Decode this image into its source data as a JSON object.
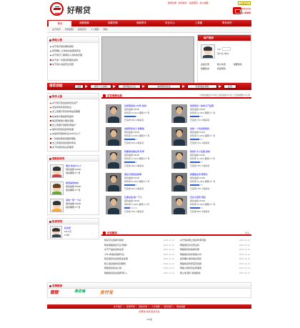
{
  "site": {
    "name": "好帮贷"
  },
  "toplinks": [
    "免费注册",
    "新手指引",
    "设置首页",
    "加入收藏"
  ],
  "register_btn": "注册会员",
  "hotline": {
    "label": "全国客服服务热线",
    "number": "400-622-4880"
  },
  "nav": [
    "首页",
    "我要借款",
    "我要贷款",
    "借款帮手",
    "安全中心",
    "工具箱",
    "联系我们"
  ],
  "subnav": [
    "关于我们",
    "风险控制",
    "担保贷款",
    "个人理财",
    "帮助"
  ],
  "notice": {
    "title": "网站公告",
    "items": [
      "关于我们借款审核通知",
      "如何确认,让你的资金更加安全",
      "关于我们了解借款人资料的管理",
      "关于第一次借款所需的资料",
      "关于用户资金安全问题"
    ]
  },
  "login": {
    "title": "用户登录",
    "uid_label": "UID",
    "avatar_tip": "用户名,你好!",
    "links": [
      "资金记录",
      "帐户充值",
      "我要借款",
      "我要投资",
      "找回密码"
    ]
  },
  "flow": {
    "title": "借贷流程:",
    "steps": [
      "注册",
      "填写个人资料",
      "身份信息认证",
      "发布借款/投资",
      "标满,借出到账",
      "还款"
    ]
  },
  "newsA": {
    "title": "换手上路",
    "items": [
      "关于我们选出最新优化资产",
      "去如何用手续费信息",
      "去三家银行存款利率是否需要",
      "在信用卡能提取现金吗",
      "借贷转帐账户服务流程",
      "去三家银行选择利率提升",
      "借款对找借出如何处理",
      "在借款有限的利息3000元以下",
      "一款借款审批流程有哪些",
      "去三家借款完成借款申请",
      "关于新借款的注意事项"
    ]
  },
  "borrowers": {
    "title": "借款指导员",
    "items": [
      {
        "name": "朋友,你在什么人",
        "amount": "借款金额:¥2000",
        "term": "借款期限:3个月"
      },
      {
        "name": "我想得到你的",
        "amount": "借款金额:¥5000",
        "term": "借款期限:3个月"
      },
      {
        "name": "满满一家一个好",
        "amount": "借款金额:¥3000",
        "term": "借款期限:3个月"
      }
    ]
  },
  "investors": {
    "title": "投资学院",
    "items": [
      {
        "name": "投资者",
        "amount": "¥11.5万",
        "term": "2.5年"
      }
    ]
  },
  "loans": {
    "title": "正在借款信息",
    "stats": "平均投资额度:¥2.99亿 | 投资总额:¥8.3亿 | 已投资笔数:6.6万笔",
    "items": [
      {
        "t": "好想借钱的小伙伴,信誉",
        "a": "借款金额:¥5000",
        "r": "年利率:19.00% 期限:6个月",
        "p": "已完成:89% 2笔投标"
      },
      {
        "t": "我想购买一些电子产品啊",
        "a": "借款金额:¥3000",
        "r": "年利率:14.00% 期限:1个月",
        "p": "已完成:74% 0笔投标"
      },
      {
        "t": "说想装修房子,我要借",
        "a": "借款金额:¥3000",
        "r": "年利率:13.00% 期限:5个月",
        "p": "已完成:82% 2笔投标"
      },
      {
        "t": "给我一个机会吧借钱",
        "a": "借款金额:¥2000",
        "r": "年利率:10.00% 期限:2个月",
        "p": "已完成:72% 1笔投标"
      },
      {
        "t": "想要借钱做生意,利率",
        "a": "借款金额:¥8000",
        "r": "年利率:14.00% 期限:6个月",
        "p": "已完成:84% 2笔投标"
      },
      {
        "t": "借钱扩大小店面,谢谢",
        "a": "借款金额:¥1500",
        "r": "年利率:11.00% 期限:1个月",
        "p": "已完成:78% 1笔投标"
      },
      {
        "t": "朋友们借钱给我啊",
        "a": "借款金额:¥5000",
        "r": "年利率:15.00% 期限:6个月",
        "p": "已完成:85% 3笔投标"
      },
      {
        "t": "我要做生意,帮帮忙",
        "a": "借款金额:¥1000",
        "r": "年利率:12.00% 期限:3个月",
        "p": "已完成:70% 1笔投标"
      },
      {
        "t": "急需资金,做一下小",
        "a": "借款金额:¥3000",
        "r": "年利率:11.00% 期限:1个月",
        "p": "已完成:45% 1笔投标"
      },
      {
        "t": "买房子装修,借钱",
        "a": "借款金额:¥2000",
        "r": "年利率:10.00% 期限:2个月",
        "p": "已完成:80% 2笔投标"
      }
    ]
  },
  "forum": {
    "title": "论坛精华",
    "left": [
      [
        "借贷平台选择与辨别",
        "2021-11-14"
      ],
      [
        "网友网络借贷平台\"陷阱\"",
        "2021-11-14"
      ],
      [
        "关于产品投资的注意",
        "2021-11-14"
      ],
      [
        "小伙,你借贷选择平台",
        "2021-11-14"
      ],
      [
        "知名借贷合法的营业执照",
        "2021-11-14"
      ],
      [
        "网上借贷放款合同细则",
        "2021-11-14"
      ],
      [
        "网络借贷投资心得",
        "2021-11-14"
      ],
      [
        "网络借贷投资选择\"陷\"入",
        "2021-11-14"
      ]
    ],
    "right": [
      [
        "关于借贷网上借贷利率管理",
        "2021-11-14"
      ],
      [
        "网络借贷平台安全吗",
        "2021-11-14"
      ],
      [
        "网络借贷的信用问题",
        "2021-11-14"
      ],
      [
        "网络借贷合作经验分享",
        "2021-11-14"
      ],
      [
        "如何确认借贷信息真实",
        "2021-11-14"
      ],
      [
        "网络借贷利率应有问题",
        "2021-11-14"
      ],
      [
        "网络小额贷款注意事项",
        "2021-11-14"
      ],
      [
        "网上借 银行 新编借款",
        "2021-11-14"
      ]
    ]
  },
  "partners": {
    "title": "友情链接",
    "logos": [
      "银联",
      "易贷通",
      "支付宝"
    ]
  },
  "footer": {
    "links": [
      "关于我们",
      "法律声明",
      "隐私条款",
      "人才招聘",
      "联系我们",
      "网站地图"
    ],
    "copy": "好帮贷(北京)安全平台",
    "icp": "ICP备"
  }
}
